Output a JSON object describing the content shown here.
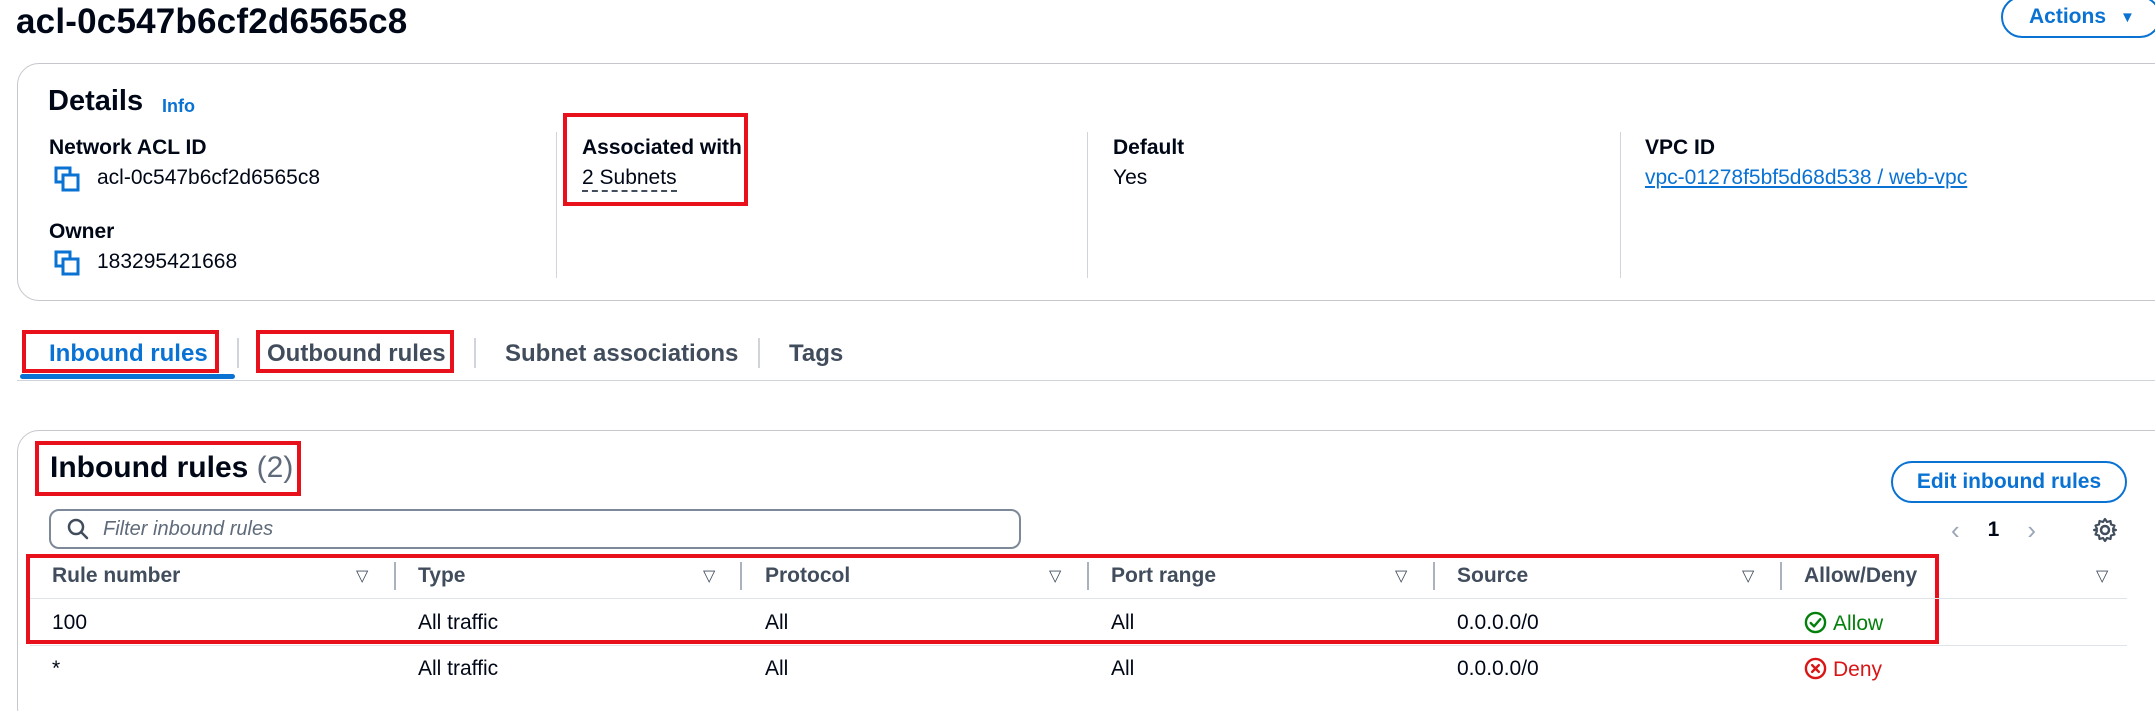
{
  "header": {
    "title": "acl-0c547b6cf2d6565c8",
    "actions_label": "Actions"
  },
  "details": {
    "title": "Details",
    "info_label": "Info",
    "network_acl_id_key": "Network ACL ID",
    "network_acl_id_val": "acl-0c547b6cf2d6565c8",
    "owner_key": "Owner",
    "owner_val": "183295421668",
    "associated_key": "Associated with",
    "associated_val": "2 Subnets",
    "default_key": "Default",
    "default_val": "Yes",
    "vpc_key": "VPC ID",
    "vpc_val": "vpc-01278f5bf5d68d538 / web-vpc"
  },
  "tabs": [
    {
      "label": "Inbound rules",
      "active": true
    },
    {
      "label": "Outbound rules",
      "active": false
    },
    {
      "label": "Subnet associations",
      "active": false
    },
    {
      "label": "Tags",
      "active": false
    }
  ],
  "rules": {
    "title": "Inbound rules",
    "count": "(2)",
    "edit_label": "Edit inbound rules",
    "filter_placeholder": "Filter inbound rules",
    "page": "1",
    "columns": [
      "Rule number",
      "Type",
      "Protocol",
      "Port range",
      "Source",
      "Allow/Deny"
    ],
    "rows": [
      {
        "rule_number": "100",
        "type": "All traffic",
        "protocol": "All",
        "port_range": "All",
        "source": "0.0.0.0/0",
        "action": "Allow"
      },
      {
        "rule_number": "*",
        "type": "All traffic",
        "protocol": "All",
        "port_range": "All",
        "source": "0.0.0.0/0",
        "action": "Deny"
      }
    ]
  },
  "icons": {
    "copy": "copy-icon",
    "search": "search-icon",
    "settings": "gear-icon",
    "allow": "check-circle-icon",
    "deny": "x-circle-icon",
    "sort": "sort-caret-icon"
  },
  "colors": {
    "link": "#0972d3",
    "allow": "#037f0c",
    "deny": "#d91515",
    "highlight": "#e8101b"
  }
}
